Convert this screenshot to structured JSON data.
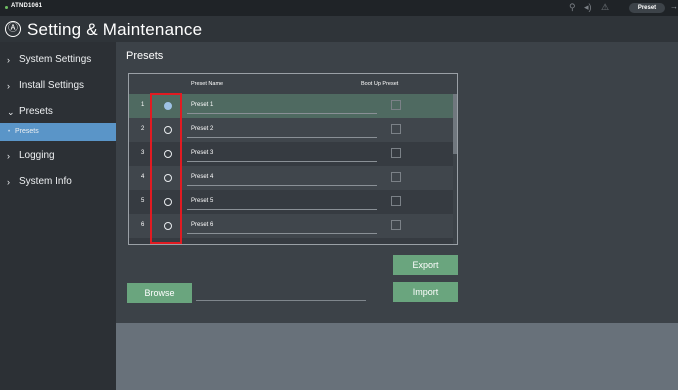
{
  "header": {
    "device_name": "ATND1061",
    "preset_button": "Preset",
    "icons": [
      "link-icon",
      "signal-icon",
      "warning-icon"
    ]
  },
  "app": {
    "title": "Setting & Maintenance",
    "logo_icon": "audio-technica-logo"
  },
  "sidebar": {
    "items": [
      {
        "label": "System Settings",
        "expanded": false
      },
      {
        "label": "Install Settings",
        "expanded": false
      },
      {
        "label": "Presets",
        "expanded": true
      },
      {
        "label": "Presets",
        "selected": true
      },
      {
        "label": "Logging",
        "expanded": false
      },
      {
        "label": "System Info",
        "expanded": false
      }
    ]
  },
  "page": {
    "title": "Presets",
    "columns": [
      "Preset Name",
      "Boot Up Preset"
    ],
    "rows": [
      {
        "num": "1",
        "name": "Preset 1",
        "selected": true
      },
      {
        "num": "2",
        "name": "Preset 2",
        "selected": false
      },
      {
        "num": "3",
        "name": "Preset 3",
        "selected": false
      },
      {
        "num": "4",
        "name": "Preset 4",
        "selected": false
      },
      {
        "num": "5",
        "name": "Preset 5",
        "selected": false
      },
      {
        "num": "6",
        "name": "Preset 6",
        "selected": false
      }
    ],
    "buttons": {
      "export": "Export",
      "browse": "Browse",
      "import": "Import"
    }
  },
  "colors": {
    "accent_green": "#6aa57e",
    "nav_selected": "#5a95c8",
    "highlight": "#e11b22"
  }
}
